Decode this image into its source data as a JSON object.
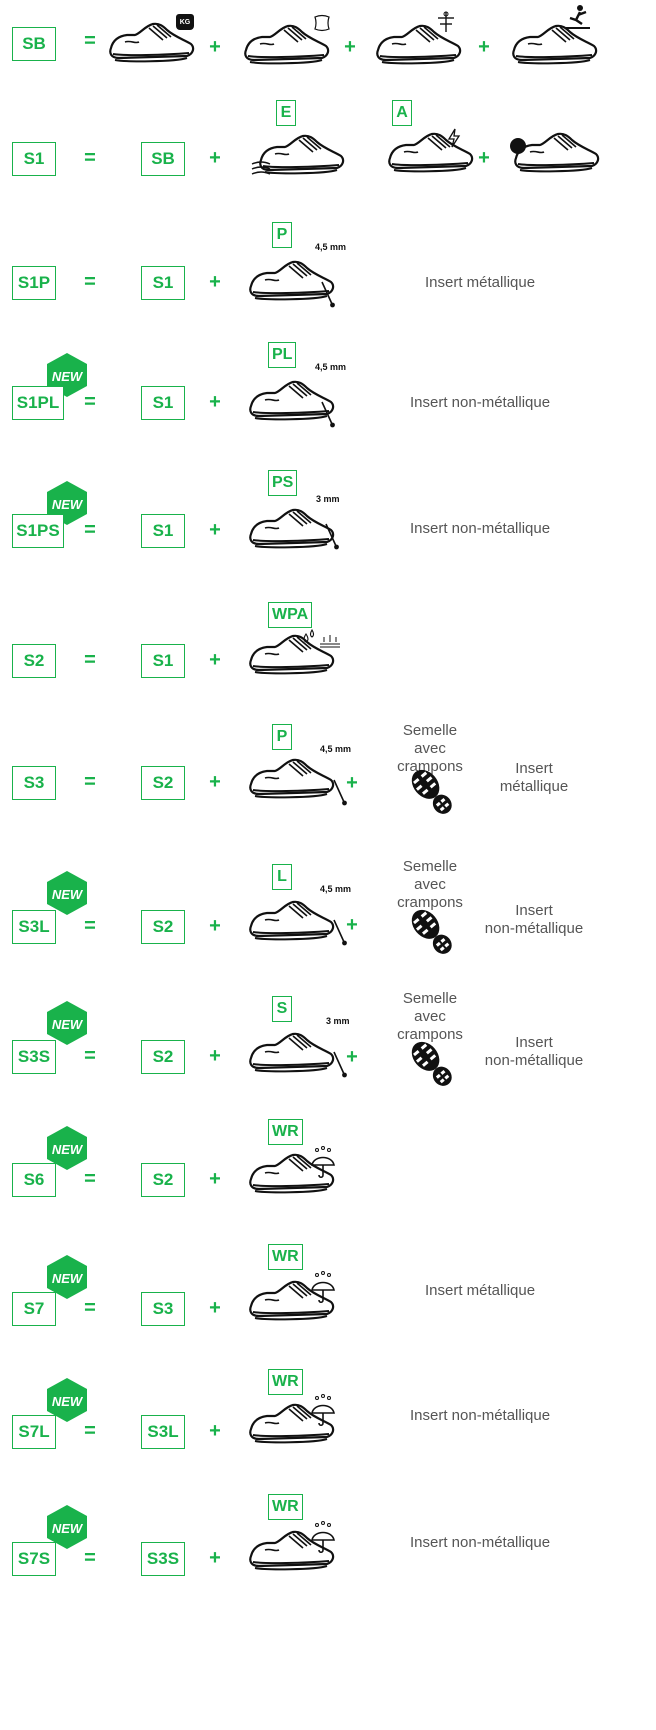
{
  "symbols": {
    "equals": "=",
    "plus": "+",
    "new_badge": "NEW",
    "kg": "KG"
  },
  "rows": [
    {
      "code": "SB",
      "base": "",
      "extras": [],
      "note": ""
    },
    {
      "code": "S1",
      "base": "SB",
      "extras": [
        "E",
        "A"
      ],
      "note": ""
    },
    {
      "code": "S1P",
      "base": "S1",
      "extras": [
        "P"
      ],
      "thickness": "4,5 mm",
      "note": "Insert métallique"
    },
    {
      "code": "S1PL",
      "base": "S1",
      "extras": [
        "PL"
      ],
      "thickness": "4,5 mm",
      "note": "Insert non-métallique",
      "is_new": true
    },
    {
      "code": "S1PS",
      "base": "S1",
      "extras": [
        "PS"
      ],
      "thickness": "3 mm",
      "note": "Insert non-métallique",
      "is_new": true
    },
    {
      "code": "S2",
      "base": "S1",
      "extras": [
        "WPA"
      ],
      "note": ""
    },
    {
      "code": "S3",
      "base": "S2",
      "extras": [
        "P"
      ],
      "thickness": "4,5 mm",
      "sole_label": "Semelle avec crampons",
      "note_line1": "Insert",
      "note_line2": "métallique"
    },
    {
      "code": "S3L",
      "base": "S2",
      "extras": [
        "L"
      ],
      "thickness": "4,5 mm",
      "sole_label": "Semelle avec crampons",
      "note_line1": "Insert",
      "note_line2": "non-métallique",
      "is_new": true
    },
    {
      "code": "S3S",
      "base": "S2",
      "extras": [
        "S"
      ],
      "thickness": "3 mm",
      "sole_label": "Semelle avec crampons",
      "note_line1": "Insert",
      "note_line2": "non-métallique",
      "is_new": true
    },
    {
      "code": "S6",
      "base": "S2",
      "extras": [
        "WR"
      ],
      "note": "",
      "is_new": true
    },
    {
      "code": "S7",
      "base": "S3",
      "extras": [
        "WR"
      ],
      "note": "Insert métallique",
      "is_new": true
    },
    {
      "code": "S7L",
      "base": "S3L",
      "extras": [
        "WR"
      ],
      "note": "Insert non-métallique",
      "is_new": true
    },
    {
      "code": "S7S",
      "base": "S3S",
      "extras": [
        "WR"
      ],
      "note": "Insert non-métallique",
      "is_new": true
    }
  ],
  "sole_label_line1": "Semelle avec",
  "sole_label_line2": "crampons",
  "colors": {
    "accent": "#19b24b",
    "text": "#555555"
  }
}
